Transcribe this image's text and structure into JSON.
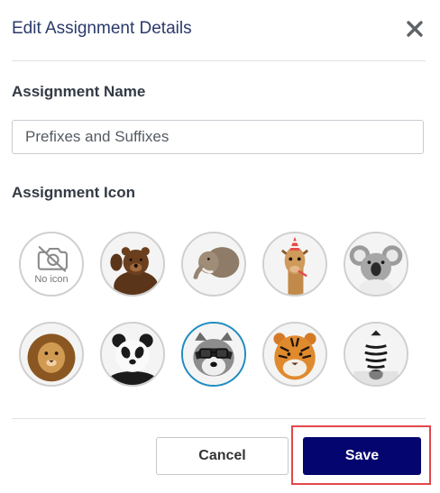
{
  "dialog": {
    "title": "Edit Assignment Details",
    "close_icon": "close-icon"
  },
  "assignment_name": {
    "label": "Assignment Name",
    "value": "Prefixes and Suffixes"
  },
  "assignment_icon": {
    "label": "Assignment Icon",
    "selected": "raccoon",
    "options": [
      {
        "id": "none",
        "label": "No icon",
        "icon": "no-camera-icon"
      },
      {
        "id": "bear",
        "icon": "bear-icon"
      },
      {
        "id": "elephant",
        "icon": "elephant-icon"
      },
      {
        "id": "giraffe",
        "icon": "giraffe-party-hat-icon"
      },
      {
        "id": "koala",
        "icon": "koala-icon"
      },
      {
        "id": "lion",
        "icon": "lion-icon"
      },
      {
        "id": "panda",
        "icon": "panda-icon"
      },
      {
        "id": "raccoon",
        "icon": "raccoon-glasses-icon"
      },
      {
        "id": "tiger",
        "icon": "tiger-icon"
      },
      {
        "id": "zebra",
        "icon": "zebra-icon"
      }
    ]
  },
  "footer": {
    "cancel_label": "Cancel",
    "save_label": "Save"
  },
  "colors": {
    "primary": "#05056f",
    "selected_ring": "#1f8cc0",
    "highlight": "#e2474b",
    "title": "#2b3a6b"
  }
}
